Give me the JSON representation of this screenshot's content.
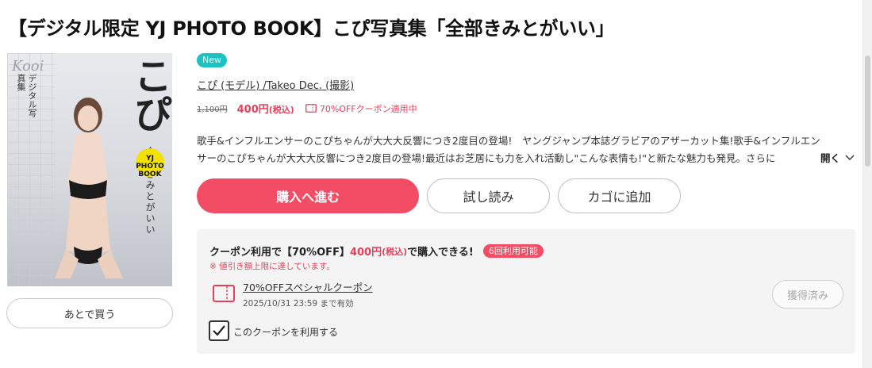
{
  "title": "【デジタル限定 YJ PHOTO BOOK】こぴ写真集「全部きみとがいい」",
  "cover": {
    "brand": "Kooi",
    "subtitle": "デジタル写真集",
    "name": "こぴ",
    "vertical_title": "全部きみとがいい",
    "badge": "YJ PHOTO BOOK"
  },
  "later_button": "あとで買う",
  "badge_new": "New",
  "author": "こぴ (モデル) /Takeo Dec. (撮影)",
  "price": {
    "old": "1,100円",
    "new": "400円",
    "tax": "(税込)",
    "coupon_tag": "70%OFFクーポン適用中"
  },
  "description": {
    "line1": "歌手&インフルエンサーのこぴちゃんが大大大反響につき2度目の登場!　ヤングジャンプ本誌グラビアのアザーカット集!歌手&インフルエン",
    "line2": "サーのこぴちゃんが大大大反響につき2度目の登場!最近はお芝居にも力を入れ活動し\"こんな表情も!\"と新たな魅力も発見。さらに",
    "more": "開く"
  },
  "buttons": {
    "buy": "購入へ進む",
    "trial": "試し読み",
    "cart": "カゴに追加"
  },
  "coupon": {
    "head_prefix": "クーポン利用で",
    "head_off": "【70%OFF】",
    "head_price": "400円",
    "head_tax": "(税込)",
    "head_suffix": "で購入できる!",
    "count": "6回利用可能",
    "note": "※ 値引き額上限に達しています。",
    "name": "70%OFFスペシャルクーポン",
    "date": "2025/10/31 23:59 まで有効",
    "acquired": "獲得済み",
    "use_label": "このクーポンを利用する",
    "use_checked": true
  },
  "colors": {
    "accent": "#f24d65",
    "new_badge": "#1bc2c2"
  }
}
